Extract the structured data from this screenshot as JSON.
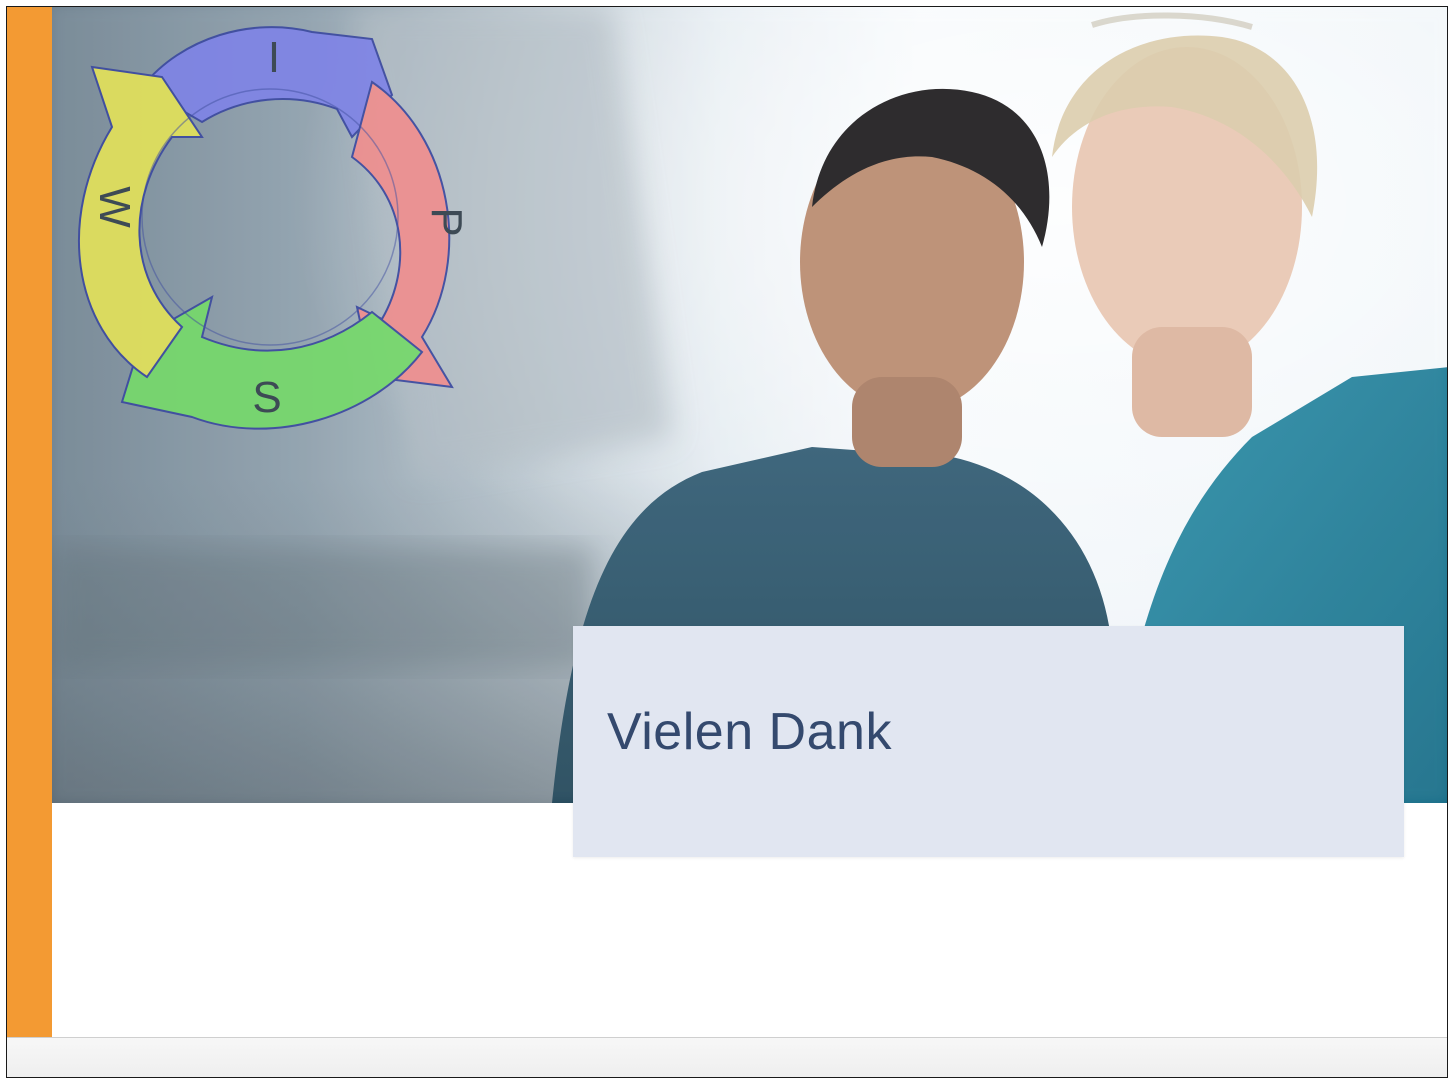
{
  "slide": {
    "title": "Vielen Dank",
    "accent_color": "#f39a33",
    "title_box_color": "#e1e6f1",
    "title_color": "#34496e"
  },
  "cycle_diagram": {
    "segments": [
      {
        "letter": "I",
        "color": "#7f84e6"
      },
      {
        "letter": "P",
        "color": "#ef8f8f"
      },
      {
        "letter": "S",
        "color": "#76d96b"
      },
      {
        "letter": "W",
        "color": "#e2e15a"
      }
    ]
  },
  "photo": {
    "description_icon": "two-people-photo"
  }
}
